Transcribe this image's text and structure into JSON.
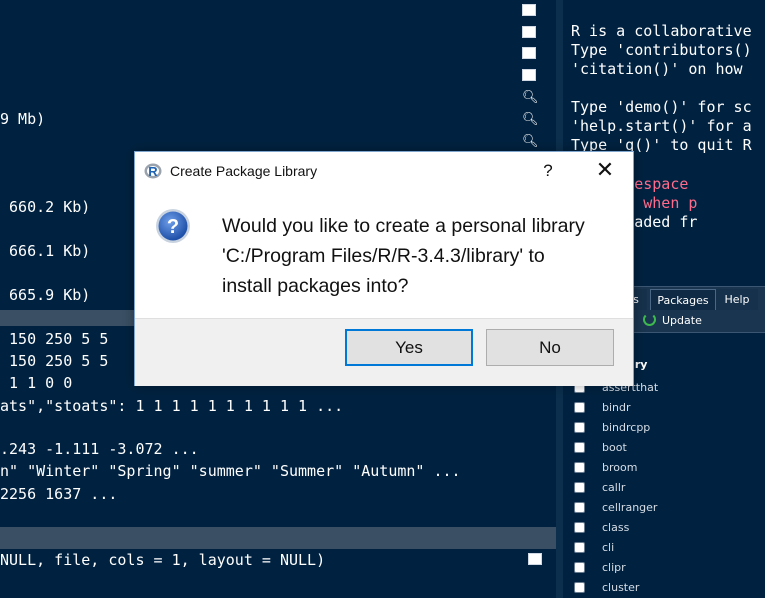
{
  "dialog": {
    "title": "Create Package Library",
    "help_label": "?",
    "close_label": "✕",
    "message_lines": [
      "Would you like to create a personal library",
      "'C:/Program Files/R/R-3.4.3/library' to",
      "install packages into?"
    ],
    "yes_label": "Yes",
    "no_label": "No",
    "r_icon_letter": "R",
    "question_icon_glyph": "?"
  },
  "console_left": {
    "lines": [
      "9 Mb)",
      " 660.2 Kb)",
      " 666.1 Kb)",
      " 665.9 Kb)",
      " 150 250 5 5",
      " 150 250 5 5",
      " 1 1 0 0",
      "ats\",\"stoats\": 1 1 1 1 1 1 1 1 1 1 ...",
      ".243 -1.111 -3.072 ...",
      "n\" \"Winter\" \"Spring\" \"summer\" \"Summer\" \"Autumn\" ...",
      "2256 1637 ...",
      "NULL, file, cols = 1, layout = NULL)"
    ]
  },
  "console_right": {
    "lines": [
      "R is a collaborative",
      "Type 'contributors()",
      "'citation()' on how",
      "",
      "Type 'demo()' for sc",
      "'help.start()' for a",
      "Type 'q()' to quit R",
      "",
      "ng: namespace",
      "obalEnv when p",
      "pace loaded fr"
    ]
  },
  "packages_pane": {
    "tabs": [
      "s",
      "Packages",
      "Help"
    ],
    "update_label": "Update",
    "library_header": "rary",
    "packages": [
      "assertthat",
      "bindr",
      "bindrcpp",
      "boot",
      "broom",
      "callr",
      "cellranger",
      "class",
      "cli",
      "clipr",
      "cluster"
    ]
  },
  "colors": {
    "background": "#002240",
    "dialog_accent": "#0078d7",
    "console_warning": "#ff6b8a"
  }
}
